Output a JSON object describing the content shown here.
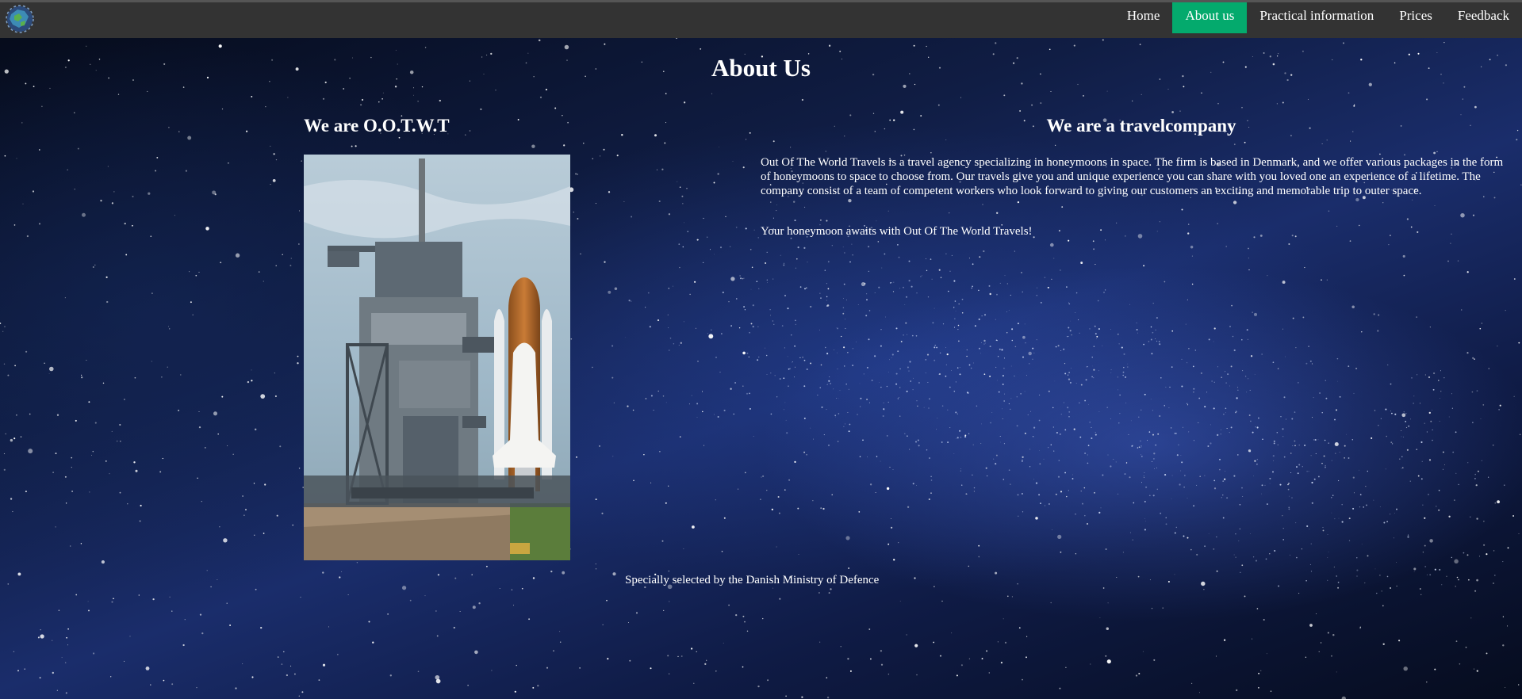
{
  "nav": {
    "items": [
      {
        "label": "Home",
        "active": false
      },
      {
        "label": "About us",
        "active": true
      },
      {
        "label": "Practical information",
        "active": false
      },
      {
        "label": "Prices",
        "active": false
      },
      {
        "label": "Feedback",
        "active": false
      }
    ],
    "background": "#333333",
    "active_color": "#04aa6d"
  },
  "page": {
    "title": "About Us"
  },
  "left": {
    "heading": "We are O.O.T.W.T"
  },
  "right": {
    "heading": "We are a travelcompany",
    "paragraph1": "Out Of The World Travels is a travel agency specializing in honeymoons in space. The firm is based in Denmark, and we offer various packages in the form of honeymoons to space to choose from. Our travels give you and unique experience you can share with you loved one an experience of a lifetime. The company consist of a team of competent workers who look forward to giving our customers an exciting and memorable trip to outer space.",
    "paragraph2": "Your honeymoon awaits with Out Of The World Travels!"
  },
  "footer": {
    "text": "Specially selected by the Danish Ministry of Defence"
  }
}
